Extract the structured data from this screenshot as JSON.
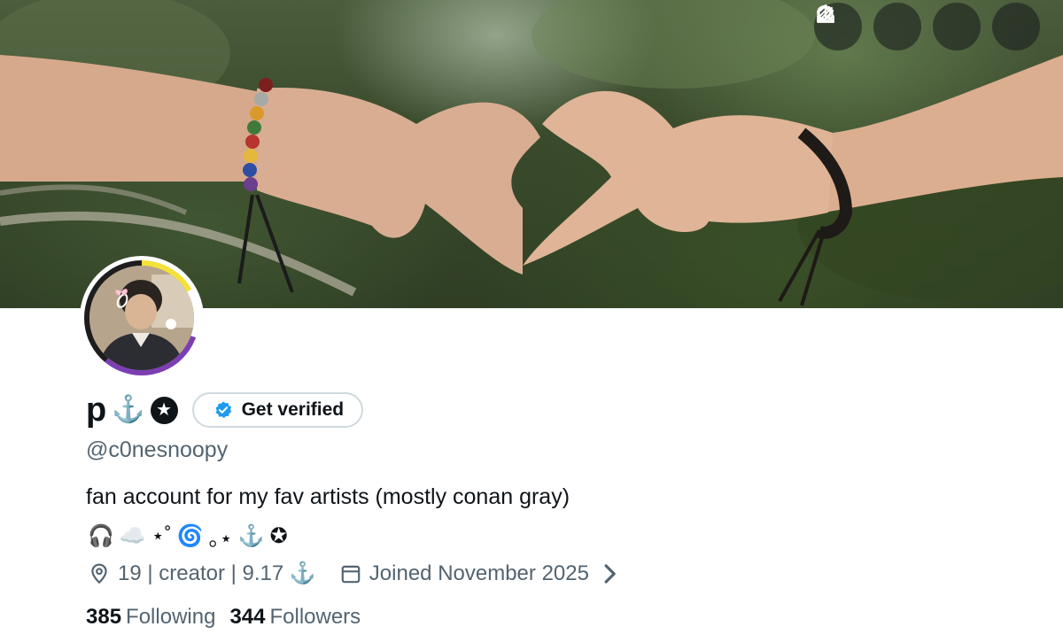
{
  "banner": {
    "description_icon": "heart-hands-photo"
  },
  "top_actions": [
    {
      "name": "grok-icon"
    },
    {
      "name": "search-icon"
    },
    {
      "name": "edit-icon"
    },
    {
      "name": "share-icon"
    }
  ],
  "profile": {
    "display_name": "p",
    "name_icons": [
      "⚓",
      "✪"
    ],
    "get_verified_label": "Get verified",
    "handle": "@c0nesnoopy",
    "bio": "fan account for my fav artists (mostly conan gray)",
    "bio_emojis": [
      "🎧",
      "☁️",
      "⋆˚",
      "🌀",
      "｡⋆",
      "⚓",
      "✪"
    ],
    "location": "19 | creator | 9.17 ⚓",
    "joined": "Joined November 2025",
    "following_count": "385",
    "following_label": "Following",
    "followers_count": "344",
    "followers_label": "Followers"
  },
  "colors": {
    "text_primary": "#0f1419",
    "text_secondary": "#536471",
    "verified_blue": "#1d9bf0",
    "border": "#cfd9de"
  }
}
